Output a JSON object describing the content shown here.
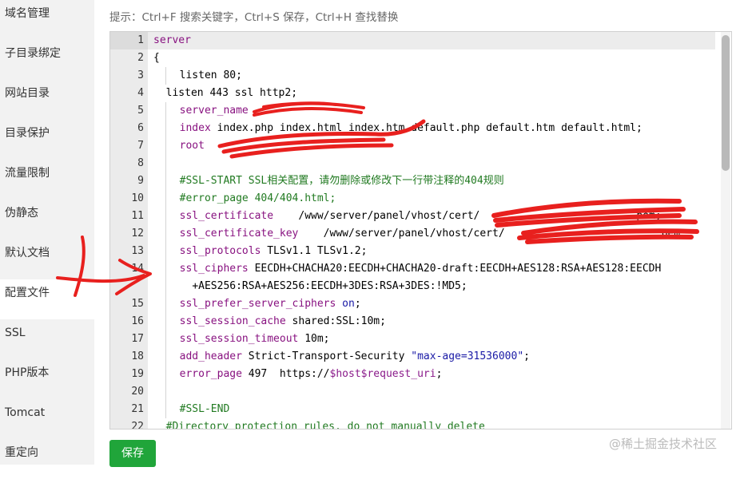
{
  "sidebar": {
    "items": [
      {
        "label": "域名管理"
      },
      {
        "label": "子目录绑定"
      },
      {
        "label": "网站目录"
      },
      {
        "label": "目录保护"
      },
      {
        "label": "流量限制"
      },
      {
        "label": "伪静态"
      },
      {
        "label": "默认文档"
      },
      {
        "label": "配置文件"
      },
      {
        "label": "SSL"
      },
      {
        "label": "PHP版本"
      },
      {
        "label": "Tomcat"
      },
      {
        "label": "重定向"
      }
    ],
    "active_item": "配置文件"
  },
  "hint": "提示：Ctrl+F 搜索关键字，Ctrl+S 保存，Ctrl+H 查找替换",
  "editor": {
    "line_numbers": [
      "1",
      "2",
      "3",
      "4",
      "5",
      "6",
      "7",
      "8",
      "9",
      "10",
      "11",
      "12",
      "13",
      "14",
      "",
      "15",
      "16",
      "17",
      "18",
      "19",
      "20",
      "21",
      "22"
    ],
    "lines": {
      "l1": "server",
      "l2": "{",
      "l3": "listen 80;",
      "l4": "listen 443 ssl http2;",
      "l5_key": "server_name",
      "l6_key": "index",
      "l6_val": " index.php index.html index.htm default.php default.htm default.html;",
      "l7_key": "root",
      "l9": "#SSL-START SSL相关配置，请勿删除或修改下一行带注释的404规则",
      "l10": "#error_page 404/404.html;",
      "l11_key": "ssl_certificate",
      "l11_val": "    /www/server/panel/vhost/cert/",
      "l11_tail": "pem;",
      "l12_key": "ssl_certificate_key",
      "l12_val": "    /www/server/panel/vhost/cert/",
      "l12_tail": "pem;",
      "l13_key": "ssl_protocols",
      "l13_val": " TLSv1.1 TLSv1.2;",
      "l14_key": "ssl_ciphers",
      "l14_val": " EECDH+CHACHA20:EECDH+CHACHA20-draft:EECDH+AES128:RSA+AES128:EECDH",
      "l14_cont": "+AES256:RSA+AES256:EECDH+3DES:RSA+3DES:!MD5;",
      "l15_key": "ssl_prefer_server_ciphers",
      "l15_val": " on",
      "l16_key": "ssl_session_cache",
      "l16_val": " shared:SSL:10m;",
      "l17_key": "ssl_session_timeout",
      "l17_val": " 10m;",
      "l18_key": "add_header",
      "l18_val": " Strict-Transport-Security ",
      "l18_str": "\"max-age=31536000\"",
      "l19_key": "error_page",
      "l19_val": " 497  https://",
      "l19_var": "$host$request_uri",
      "l21": "#SSL-END",
      "l22": "#Directory protection rules, do not manually delete"
    }
  },
  "save_label": "保存",
  "watermark": "@稀土掘金技术社区",
  "colors": {
    "save": "#20a53a",
    "scribble": "#e8201e",
    "keyword": "#881280",
    "comment": "#217a21"
  }
}
